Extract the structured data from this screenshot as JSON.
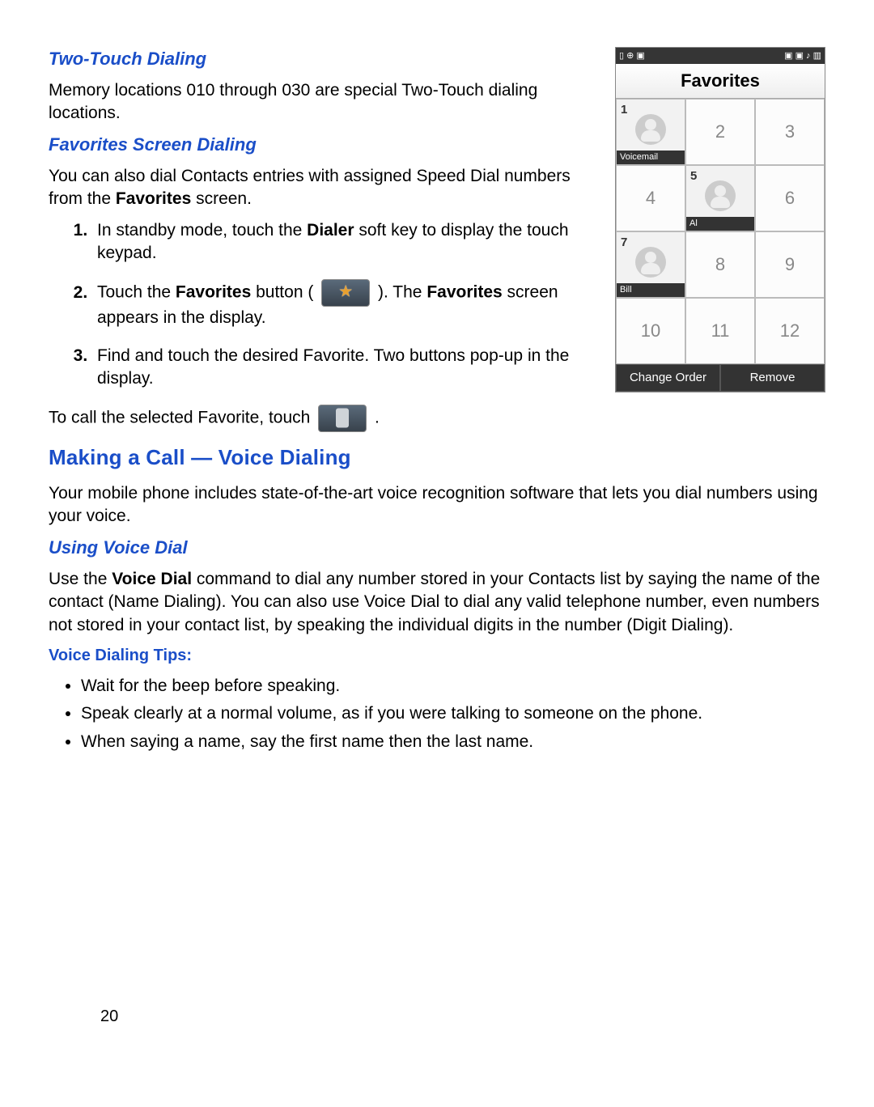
{
  "sections": {
    "two_touch": {
      "heading": "Two-Touch Dialing",
      "para": "Memory locations 010 through 030 are special Two-Touch dialing locations."
    },
    "fav_screen": {
      "heading": "Favorites Screen Dialing",
      "intro_a": "You can also dial Contacts entries with assigned Speed Dial numbers from the ",
      "intro_bold": "Favorites",
      "intro_b": " screen.",
      "steps": {
        "s1a": "In standby mode, touch the ",
        "s1bold": "Dialer",
        "s1b": " soft key to display the touch keypad.",
        "s2a": "Touch the ",
        "s2bold": "Favorites",
        "s2b": " button ( ",
        "s2c": " ). The ",
        "s2bold2": "Favorites",
        "s2d": " screen appears in the display.",
        "s3": "Find and touch the desired Favorite. Two buttons pop-up in the display."
      },
      "call_line_a": "To call the selected Favorite, touch ",
      "call_line_b": " ."
    },
    "voice_call": {
      "heading": "Making a Call — Voice Dialing",
      "para": "Your mobile phone includes state-of-the-art voice recognition software that lets you dial numbers using your voice."
    },
    "using_voice": {
      "heading": "Using Voice Dial",
      "p_a": "Use the ",
      "p_bold": "Voice Dial",
      "p_b": " command to dial any number stored in your Contacts list by saying the name of the contact (Name Dialing). You can also use Voice Dial to dial any valid telephone number, even numbers not stored in your contact list, by speaking the individual digits in the number (Digit Dialing)."
    },
    "tips": {
      "heading": "Voice Dialing Tips:",
      "items": [
        "Wait for the beep before speaking.",
        "Speak clearly at a normal volume, as if you were talking to someone on the phone.",
        "When saying a name, say the first name then the last name."
      ]
    }
  },
  "phone": {
    "status_left": "▯  ⊕ ▣",
    "status_right": "▣ ▣ ♪ ▥",
    "title": "Favorites",
    "cells": [
      {
        "n": "1",
        "label": "Voicemail",
        "active": true,
        "avatar": true,
        "tl": true
      },
      {
        "n": "2"
      },
      {
        "n": "3"
      },
      {
        "n": "4"
      },
      {
        "n": "5",
        "label": "Al",
        "active": true,
        "avatar": true,
        "tl": true
      },
      {
        "n": "6"
      },
      {
        "n": "7",
        "label": "Bill",
        "active": true,
        "avatar": true,
        "tl": true
      },
      {
        "n": "8"
      },
      {
        "n": "9"
      },
      {
        "n": "10"
      },
      {
        "n": "11"
      },
      {
        "n": "12"
      }
    ],
    "soft_left": "Change Order",
    "soft_right": "Remove"
  },
  "page_number": "20"
}
